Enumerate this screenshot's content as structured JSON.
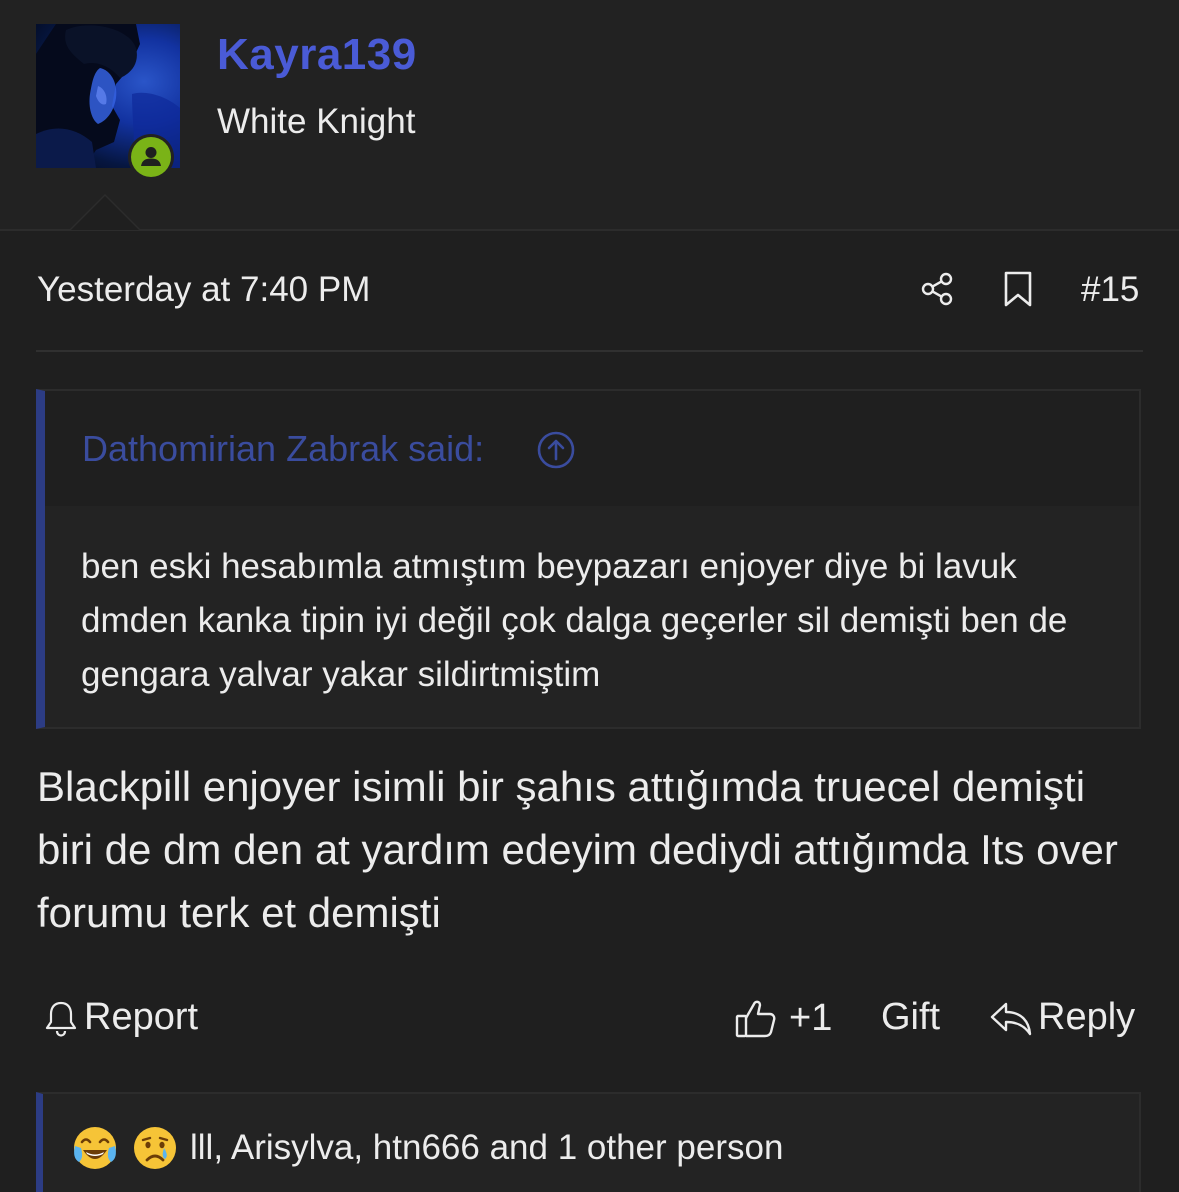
{
  "user": {
    "username": "Kayra139",
    "title": "White Knight",
    "avatar_icon": "user-avatar-photo",
    "status_icon": "online-user-icon",
    "username_color": "#4a5bd6",
    "status_color": "#7ab317"
  },
  "post": {
    "time": "Yesterday at 7:40 PM",
    "number": "#15",
    "share_icon": "share-icon",
    "bookmark_icon": "bookmark-icon",
    "body": "Blackpill enjoyer isimli bir şahıs attığımda truecel demişti biri de dm den at yardım edeyim dediydi attığımda Its over forumu terk et demişti"
  },
  "quote": {
    "author": "Dathomirian Zabrak said:",
    "jump_icon": "arrow-up-circle-icon",
    "text": "ben eski hesabımla atmıştım beypazarı enjoyer diye bi lavuk dmden kanka tipin iyi değil çok dalga geçerler sil demişti ben de gengara yalvar yakar sildirtmiştim",
    "accent_color": "#2c3c84"
  },
  "actions": {
    "report": "Report",
    "like": "+1",
    "gift": "Gift",
    "reply": "Reply"
  },
  "reactions": {
    "emojis": [
      "laughing-tears-emoji",
      "crying-emoji"
    ],
    "text": "lll, Arisylva, htn666 and 1 other person"
  }
}
